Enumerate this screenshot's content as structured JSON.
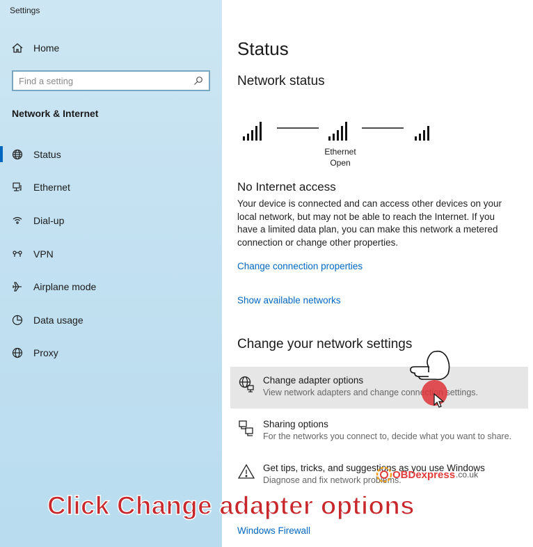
{
  "app": {
    "title": "Settings"
  },
  "sidebar": {
    "home_label": "Home",
    "search_placeholder": "Find a setting",
    "section_title": "Network & Internet",
    "items": [
      {
        "label": "Status",
        "icon": "globe-icon",
        "active": true
      },
      {
        "label": "Ethernet",
        "icon": "ethernet-icon"
      },
      {
        "label": "Dial-up",
        "icon": "dialup-icon"
      },
      {
        "label": "VPN",
        "icon": "vpn-icon"
      },
      {
        "label": "Airplane mode",
        "icon": "airplane-icon"
      },
      {
        "label": "Data usage",
        "icon": "data-usage-icon"
      },
      {
        "label": "Proxy",
        "icon": "globe-icon"
      }
    ]
  },
  "main": {
    "title": "Status",
    "network_status_title": "Network status",
    "diagram": {
      "connection_name": "Ethernet",
      "connection_type": "Open"
    },
    "status_heading": "No Internet access",
    "status_description": "Your device is connected and can access other devices on your local network, but may not be able to reach the Internet. If you have a limited data plan, you can make this network a metered connection or change other properties.",
    "link_change_properties": "Change connection properties",
    "link_show_networks": "Show available networks",
    "change_settings_title": "Change your network settings",
    "options": [
      {
        "title": "Change adapter options",
        "desc": "View network adapters and change connection settings.",
        "icon": "adapter-icon"
      },
      {
        "title": "Sharing options",
        "desc": "For the networks you connect to, decide what you want to share.",
        "icon": "sharing-icon"
      },
      {
        "title": "Get tips, tricks, and suggestions as you use Windows",
        "desc": "Diagnose and fix network problems.",
        "icon": "warning-icon"
      }
    ],
    "link_windows_firewall": "Windows Firewall"
  },
  "overlay": {
    "caption": "Click Change adapter options",
    "watermark_brand": "OBDexpress",
    "watermark_domain": ".co.uk"
  },
  "colors": {
    "accent": "#0067c0",
    "caption": "#c8282b",
    "sidebar_bg": "#c3e1f1"
  }
}
